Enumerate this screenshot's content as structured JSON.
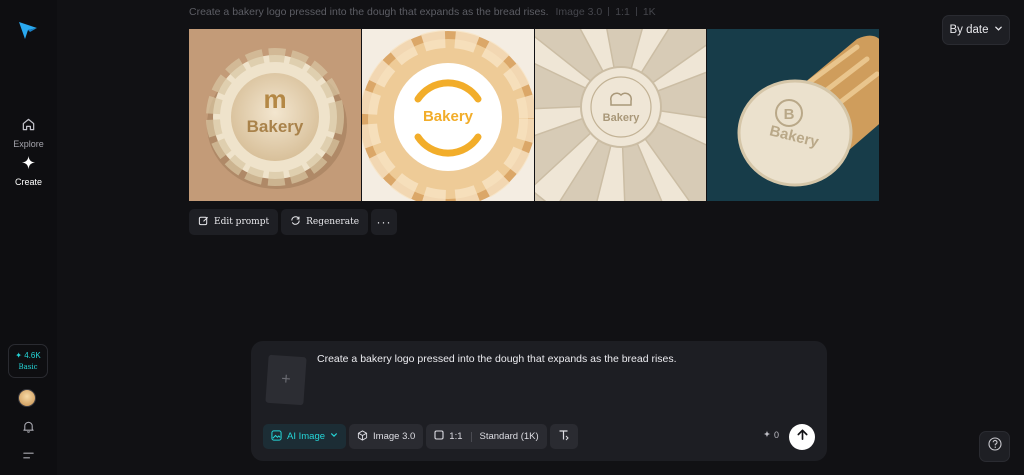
{
  "sidebar": {
    "logo": "paper-plane-logo",
    "nav": [
      {
        "label": "Explore",
        "icon": "home-icon"
      },
      {
        "label": "Create",
        "icon": "sparkle-icon"
      }
    ],
    "credits": {
      "amount": "✦ 4.6K",
      "plan": "Basic"
    }
  },
  "prompt_header": {
    "text": "Create a bakery logo pressed into the dough that expands as the bread rises.",
    "model": "Image 3.0",
    "ratio": "1:1",
    "resolution": "1K"
  },
  "sort": {
    "label": "By date"
  },
  "images": [
    {
      "name": "twisted-dough-wreath-logo"
    },
    {
      "name": "bread-ring-bakery-logo"
    },
    {
      "name": "sunburst-dough-embossed-logo"
    },
    {
      "name": "baguette-stamped-logo"
    }
  ],
  "image_text": {
    "t1": "Bakery",
    "t2": "Bakery",
    "t3": "Bakery",
    "t4": "Bakery"
  },
  "actions": {
    "edit_prompt": "Edit prompt",
    "regenerate": "Regenerate",
    "more": "···"
  },
  "composer": {
    "prompt": "Create a bakery logo pressed into the dough that expands as the bread rises.",
    "attach_symbol": "+",
    "mode": "AI Image",
    "model": "Image 3.0",
    "ratio": "1:1",
    "quality": "Standard (1K)",
    "cost": "0"
  },
  "colors": {
    "accent": "#25d6d8",
    "background": "#111114",
    "panel": "#1d1e23"
  }
}
